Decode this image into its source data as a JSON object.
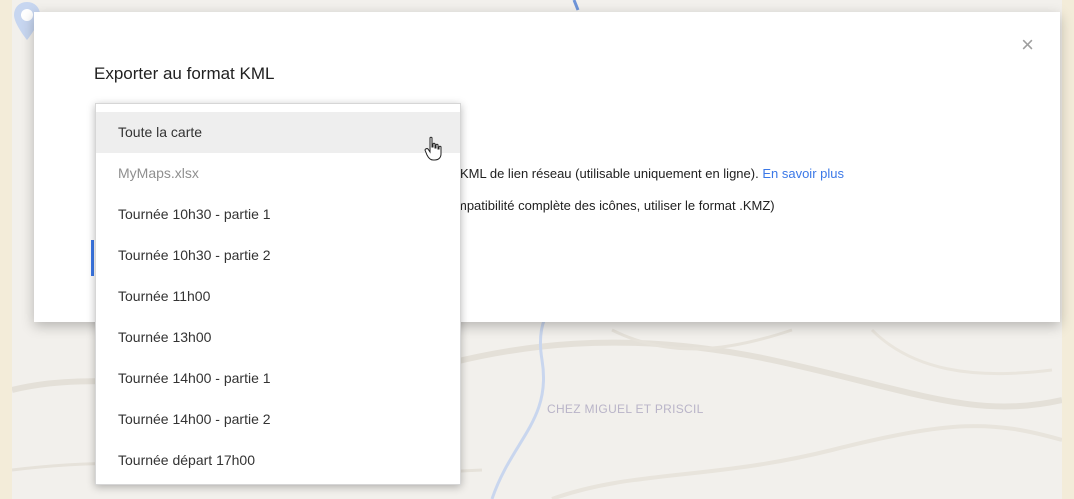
{
  "map": {
    "place_label": "CHEZ MIGUEL ET PRISCIL"
  },
  "dialog": {
    "title": "Exporter au format KML",
    "close_glyph": "×",
    "option_line_1_visible": "KML de lien réseau (utilisable uniquement en ligne).",
    "learn_more_link": "En savoir plus",
    "option_line_2_visible": "mpatibilité complète des icônes, utiliser le format .KMZ)"
  },
  "dropdown": {
    "items": [
      {
        "label": "Toute la carte",
        "state": "highlighted"
      },
      {
        "label": "MyMaps.xlsx",
        "state": "muted"
      },
      {
        "label": "Tournée 10h30 - partie 1"
      },
      {
        "label": "Tournée 10h30 - partie 2"
      },
      {
        "label": "Tournée 11h00"
      },
      {
        "label": "Tournée 13h00"
      },
      {
        "label": "Tournée 14h00 - partie 1"
      },
      {
        "label": "Tournée 14h00 - partie 2"
      },
      {
        "label": "Tournée départ 17h00"
      }
    ]
  },
  "colors": {
    "accent": "#3b78e7",
    "highlight": "#eeeeee",
    "frame_background": "#f3ecd9"
  },
  "icons": {
    "close": "close-icon",
    "cursor": "hand-pointer-icon",
    "map_pin": "map-pin-icon"
  }
}
